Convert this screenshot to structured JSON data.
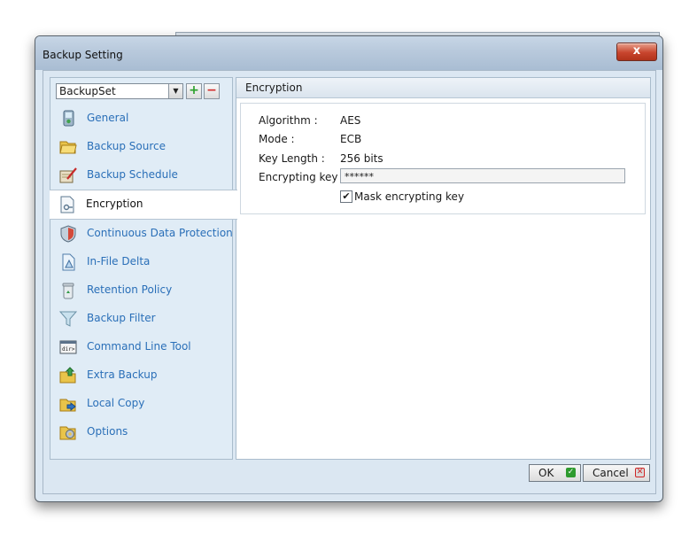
{
  "window": {
    "title": "Backup Setting",
    "close_glyph": "x"
  },
  "backupset": {
    "selected": "BackupSet",
    "add_glyph": "+",
    "remove_glyph": "−"
  },
  "nav": [
    {
      "label": "General",
      "icon": "general-icon"
    },
    {
      "label": "Backup Source",
      "icon": "folder-icon"
    },
    {
      "label": "Backup Schedule",
      "icon": "schedule-icon"
    },
    {
      "label": "Encryption",
      "icon": "encryption-icon",
      "selected": true
    },
    {
      "label": "Continuous Data Protection",
      "icon": "shield-icon"
    },
    {
      "label": "In-File Delta",
      "icon": "delta-icon"
    },
    {
      "label": "Retention Policy",
      "icon": "recycle-icon"
    },
    {
      "label": "Backup Filter",
      "icon": "filter-icon"
    },
    {
      "label": "Command Line Tool",
      "icon": "terminal-icon"
    },
    {
      "label": "Extra Backup",
      "icon": "extra-backup-icon"
    },
    {
      "label": "Local Copy",
      "icon": "local-copy-icon"
    },
    {
      "label": "Options",
      "icon": "options-icon"
    }
  ],
  "encryption": {
    "heading": "Encryption",
    "algorithm_label": "Algorithm :",
    "algorithm_value": "AES",
    "mode_label": "Mode :",
    "mode_value": "ECB",
    "keylength_label": "Key Length :",
    "keylength_value": "256 bits",
    "key_label": "Encrypting key :",
    "key_value": "******",
    "mask_label": "Mask encrypting key",
    "mask_checked": true
  },
  "buttons": {
    "ok": "OK",
    "cancel": "Cancel"
  },
  "colors": {
    "nav_link": "#2a6fb8",
    "ok_icon": "#2f9b2f",
    "cancel_icon": "#d02525"
  }
}
